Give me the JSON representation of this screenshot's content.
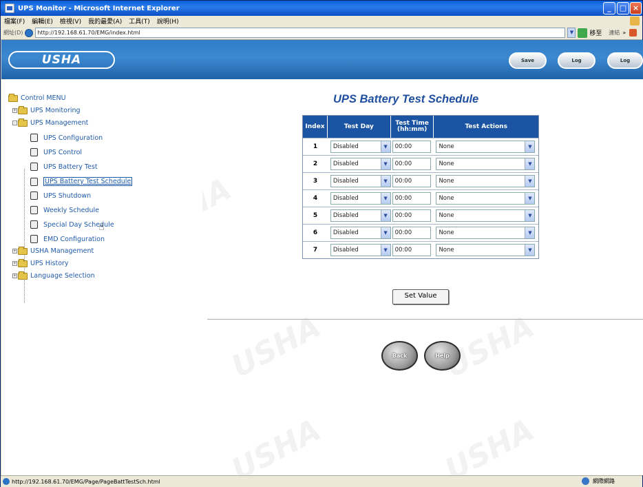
{
  "window": {
    "title": "UPS Monitor - Microsoft Internet Explorer",
    "menu": [
      "檔案(F)",
      "編輯(E)",
      "檢視(V)",
      "我的最愛(A)",
      "工具(T)",
      "說明(H)"
    ],
    "address_label": "網址(D)",
    "address_url": "http://192.168.61.70/EMG/index.html",
    "go_label": "移至",
    "links_label": "連結",
    "links_chevron": "»"
  },
  "header": {
    "logo": "USHA",
    "buttons": [
      {
        "label": "Save",
        "icon": "save-icon"
      },
      {
        "label": "Log",
        "icon": "log-icon"
      },
      {
        "label": "Log",
        "icon": "logout-icon"
      }
    ]
  },
  "tree": {
    "root": "Control MENU",
    "items": [
      {
        "label": "UPS Monitoring",
        "type": "folder",
        "level": 1,
        "expander": "+"
      },
      {
        "label": "UPS Management",
        "type": "folder",
        "level": 1,
        "expander": "-"
      },
      {
        "label": "UPS Configuration",
        "type": "page",
        "level": 2
      },
      {
        "label": "UPS Control",
        "type": "page",
        "level": 2
      },
      {
        "label": "UPS Battery Test",
        "type": "page",
        "level": 2
      },
      {
        "label": "UPS Battery Test Schedule",
        "type": "page",
        "level": 2,
        "selected": true
      },
      {
        "label": "UPS Shutdown",
        "type": "page",
        "level": 2
      },
      {
        "label": "Weekly Schedule",
        "type": "page",
        "level": 2
      },
      {
        "label": "Special Day Schedule",
        "type": "page",
        "level": 2
      },
      {
        "label": "EMD Configuration",
        "type": "page",
        "level": 2
      },
      {
        "label": "USHA Management",
        "type": "folder",
        "level": 1,
        "expander": "+"
      },
      {
        "label": "UPS History",
        "type": "folder",
        "level": 1,
        "expander": "+"
      },
      {
        "label": "Language Selection",
        "type": "folder",
        "level": 1,
        "expander": "+"
      }
    ]
  },
  "main": {
    "title": "UPS Battery Test Schedule",
    "columns": {
      "index": "Index",
      "day": "Test Day",
      "time": "Test Time (hh:mm)",
      "action": "Test Actions"
    },
    "rows": [
      {
        "index": "1",
        "day": "Disabled",
        "time": "00:00",
        "action": "None"
      },
      {
        "index": "2",
        "day": "Disabled",
        "time": "00:00",
        "action": "None"
      },
      {
        "index": "3",
        "day": "Disabled",
        "time": "00:00",
        "action": "None"
      },
      {
        "index": "4",
        "day": "Disabled",
        "time": "00:00",
        "action": "None"
      },
      {
        "index": "5",
        "day": "Disabled",
        "time": "00:00",
        "action": "None"
      },
      {
        "index": "6",
        "day": "Disabled",
        "time": "00:00",
        "action": "None"
      },
      {
        "index": "7",
        "day": "Disabled",
        "time": "00:00",
        "action": "None"
      }
    ],
    "set_value_label": "Set Value",
    "back_label": "Back",
    "help_label": "Help"
  },
  "status": {
    "url": "http://192.168.61.70/EMG/Page/PageBattTestSch.html",
    "zone": "網際網路"
  },
  "colors": {
    "header_blue": "#2f7dc8",
    "table_header": "#1a54a3",
    "title_blue": "#1f4f9e",
    "link_blue": "#1f5aa8"
  }
}
